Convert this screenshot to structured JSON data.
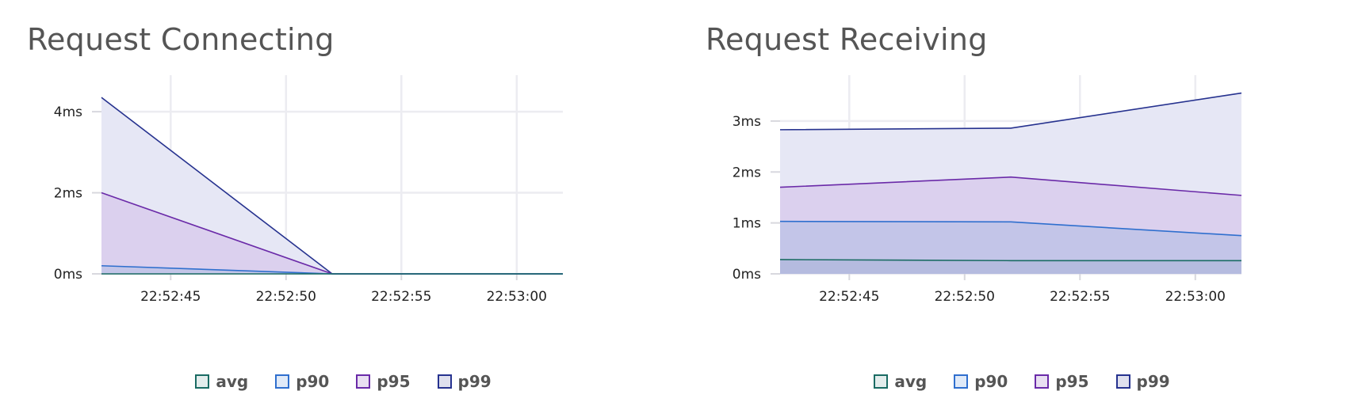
{
  "colors": {
    "avg": "#1a6b63",
    "p90": "#2f6fce",
    "p95": "#6a2aa8",
    "p99": "#26328f",
    "grid": "#ececf1"
  },
  "chart_data": [
    {
      "type": "area",
      "title": "Request Connecting",
      "x": [
        "22:52:42",
        "22:52:52",
        "22:53:02"
      ],
      "x_ticks": [
        "22:52:45",
        "22:52:50",
        "22:52:55",
        "22:53:00"
      ],
      "y_ticks": [
        "0ms",
        "2ms",
        "4ms"
      ],
      "y_tick_values": [
        0,
        2,
        4
      ],
      "ylim": [
        0,
        4.9
      ],
      "grid": true,
      "legend_position": "bottom",
      "series": [
        {
          "name": "avg",
          "values": [
            0.0,
            0.0,
            0.0
          ]
        },
        {
          "name": "p90",
          "values": [
            0.2,
            0.0,
            0.0
          ]
        },
        {
          "name": "p95",
          "values": [
            2.0,
            0.0,
            0.0
          ]
        },
        {
          "name": "p99",
          "values": [
            4.35,
            0.0,
            0.0
          ]
        }
      ]
    },
    {
      "type": "area",
      "title": "Request Receiving",
      "x": [
        "22:52:42",
        "22:52:52",
        "22:53:02"
      ],
      "x_ticks": [
        "22:52:45",
        "22:52:50",
        "22:52:55",
        "22:53:00"
      ],
      "y_ticks": [
        "0ms",
        "1ms",
        "2ms",
        "3ms"
      ],
      "y_tick_values": [
        0,
        1,
        2,
        3
      ],
      "ylim": [
        0,
        3.9
      ],
      "grid": true,
      "legend_position": "bottom",
      "series": [
        {
          "name": "avg",
          "values": [
            0.28,
            0.26,
            0.26
          ]
        },
        {
          "name": "p90",
          "values": [
            1.03,
            1.02,
            0.75
          ]
        },
        {
          "name": "p95",
          "values": [
            1.7,
            1.9,
            1.54
          ]
        },
        {
          "name": "p99",
          "values": [
            2.83,
            2.86,
            3.55
          ]
        }
      ]
    }
  ]
}
